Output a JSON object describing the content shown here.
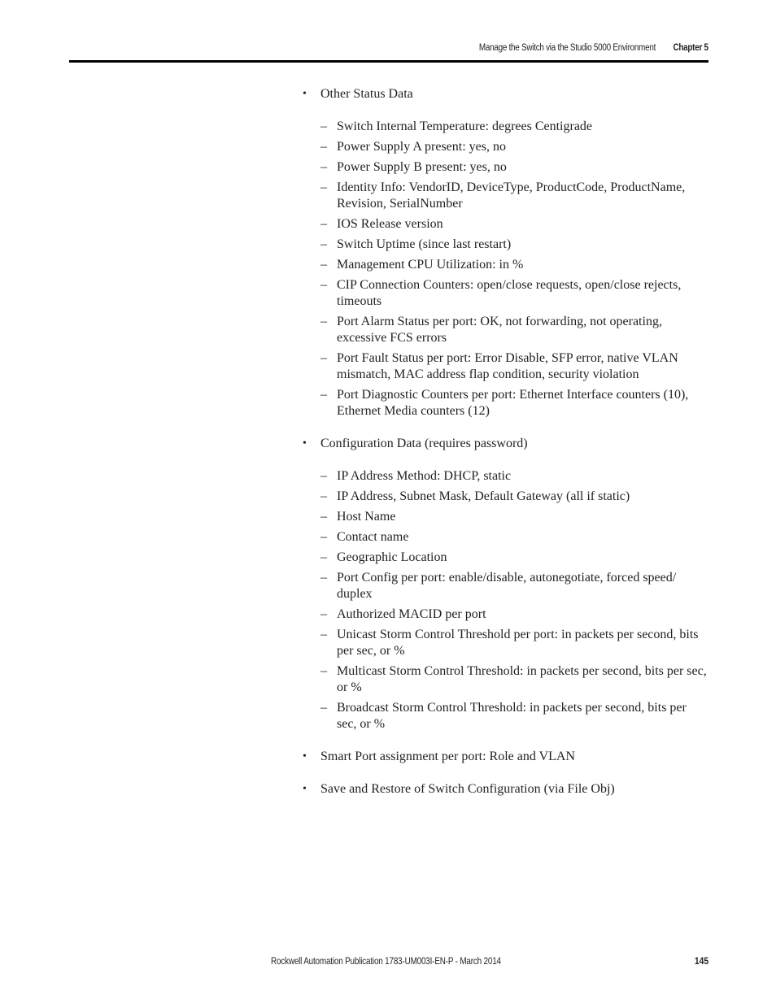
{
  "header": {
    "running_title": "Manage the Switch via the Studio 5000 Environment",
    "chapter": "Chapter 5"
  },
  "content": {
    "sections": [
      {
        "label": "Other Status Data",
        "items": [
          "Switch Internal Temperature: degrees Centigrade",
          "Power Supply A present: yes, no",
          "Power Supply B present: yes, no",
          "Identity Info: VendorID, DeviceType, ProductCode, ProductName, Revision, SerialNumber",
          "IOS Release version",
          "Switch Uptime (since last restart)",
          "Management CPU Utilization: in %",
          "CIP Connection Counters: open/close requests, open/close rejects, timeouts",
          "Port Alarm Status per port: OK, not forwarding, not operating, excessive FCS errors",
          "Port Fault Status per port: Error Disable, SFP error, native VLAN mismatch, MAC address flap condition, security violation",
          "Port Diagnostic Counters per port: Ethernet Interface counters (10), Ethernet Media counters (12)"
        ]
      },
      {
        "label": "Configuration Data (requires password)",
        "items": [
          "IP Address Method: DHCP, static",
          "IP Address, Subnet Mask, Default Gateway (all if static)",
          "Host Name",
          "Contact name",
          "Geographic Location",
          "Port Config per port: enable/disable, autonegotiate, forced speed/ duplex",
          "Authorized MACID per port",
          "Unicast Storm Control Threshold per port: in packets per second, bits per sec, or %",
          "Multicast Storm Control Threshold: in packets per second, bits per sec, or %",
          "Broadcast Storm Control Threshold: in packets per second, bits per sec, or %"
        ]
      },
      {
        "label": "Smart Port assignment per port: Role and VLAN",
        "items": []
      },
      {
        "label": "Save and Restore of Switch Configuration (via File Obj)",
        "items": []
      }
    ],
    "bullet_glyph": "•",
    "dash_glyph": "–"
  },
  "footer": {
    "publication": "Rockwell Automation Publication 1783-UM003I-EN-P - March 2014",
    "page_number": "145"
  }
}
